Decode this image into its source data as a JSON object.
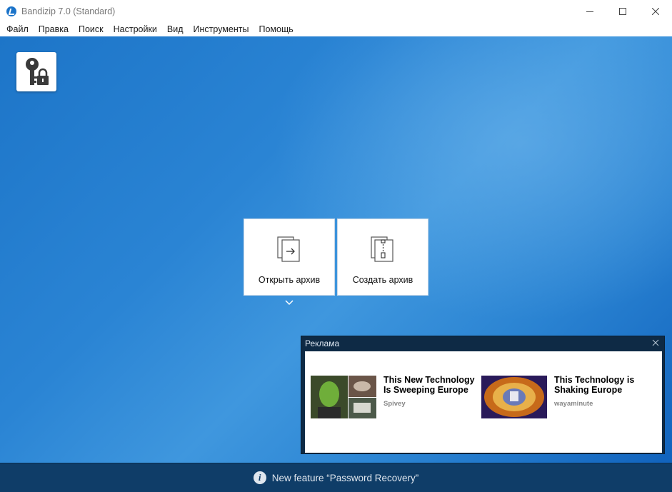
{
  "window": {
    "title": "Bandizip 7.0 (Standard)",
    "controls": [
      "minimize-icon",
      "maximize-icon",
      "close-icon"
    ]
  },
  "menu": {
    "items": [
      "Файл",
      "Правка",
      "Поиск",
      "Настройки",
      "Вид",
      "Инструменты",
      "Помощь"
    ]
  },
  "main": {
    "password_tile_icon": "key-lock-icon",
    "actions": [
      {
        "label": "Открыть архив",
        "icon": "open-archive-icon"
      },
      {
        "label": "Создать архив",
        "icon": "create-archive-icon"
      }
    ],
    "more_icon": "chevron-down-icon"
  },
  "ad": {
    "header": "Реклама",
    "cards": [
      {
        "title": "This New Technology Is Sweeping Europe",
        "source": "Spivey"
      },
      {
        "title": "This Technology is Shaking Europe",
        "source": "wayaminute"
      }
    ]
  },
  "status": {
    "icon": "info-icon",
    "text": "New feature “Password Recovery”"
  },
  "colors": {
    "main_bg": "#2a84d4",
    "ad_frame": "#0e2a45",
    "status_bar": "#0f3d68"
  }
}
